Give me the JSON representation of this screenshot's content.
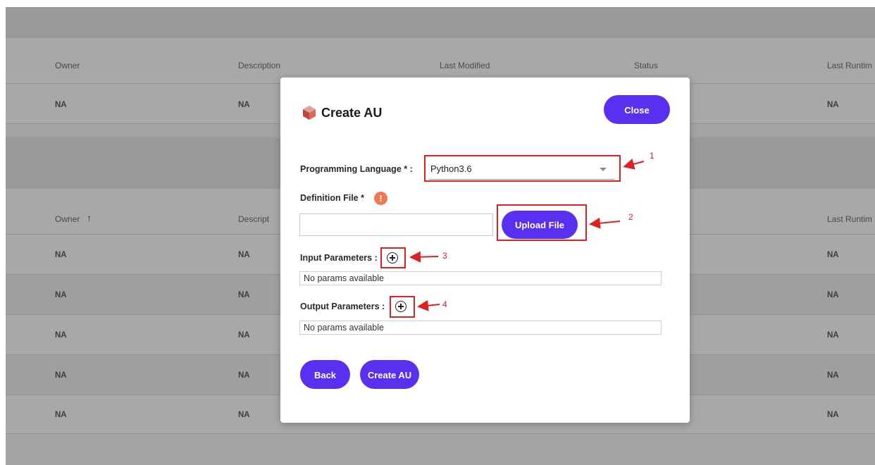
{
  "table_top": {
    "columns": [
      "Owner",
      "Description",
      "Last Modified",
      "Status",
      "Last Runtim"
    ],
    "rows": [
      [
        "NA",
        "NA",
        "",
        "",
        "NA"
      ]
    ]
  },
  "table_bottom": {
    "columns": [
      "Owner",
      "Descript",
      "Last Runtim"
    ],
    "sort_icon": "arrow-up-icon",
    "rows": [
      [
        "NA",
        "NA",
        "NA"
      ],
      [
        "NA",
        "NA",
        "NA"
      ],
      [
        "NA",
        "NA",
        "NA"
      ],
      [
        "NA",
        "NA",
        "NA"
      ],
      [
        "NA",
        "NA",
        "NA"
      ]
    ]
  },
  "modal": {
    "title": "Create AU",
    "title_icon": "cube-icon",
    "close_label": "Close",
    "programming_language_label": "Programming Language * :",
    "programming_language_value": "Python3.6",
    "definition_file_label": "Definition File *",
    "info_icon_glyph": "!",
    "definition_file_value": "",
    "upload_label": "Upload File",
    "input_params_label": "Input Parameters :",
    "input_params_empty": "No params available",
    "output_params_label": "Output Parameters :",
    "output_params_empty": "No params available",
    "back_label": "Back",
    "create_label": "Create AU",
    "accent_color": "#5b2ff0"
  },
  "annotations": [
    "1",
    "2",
    "3",
    "4"
  ]
}
